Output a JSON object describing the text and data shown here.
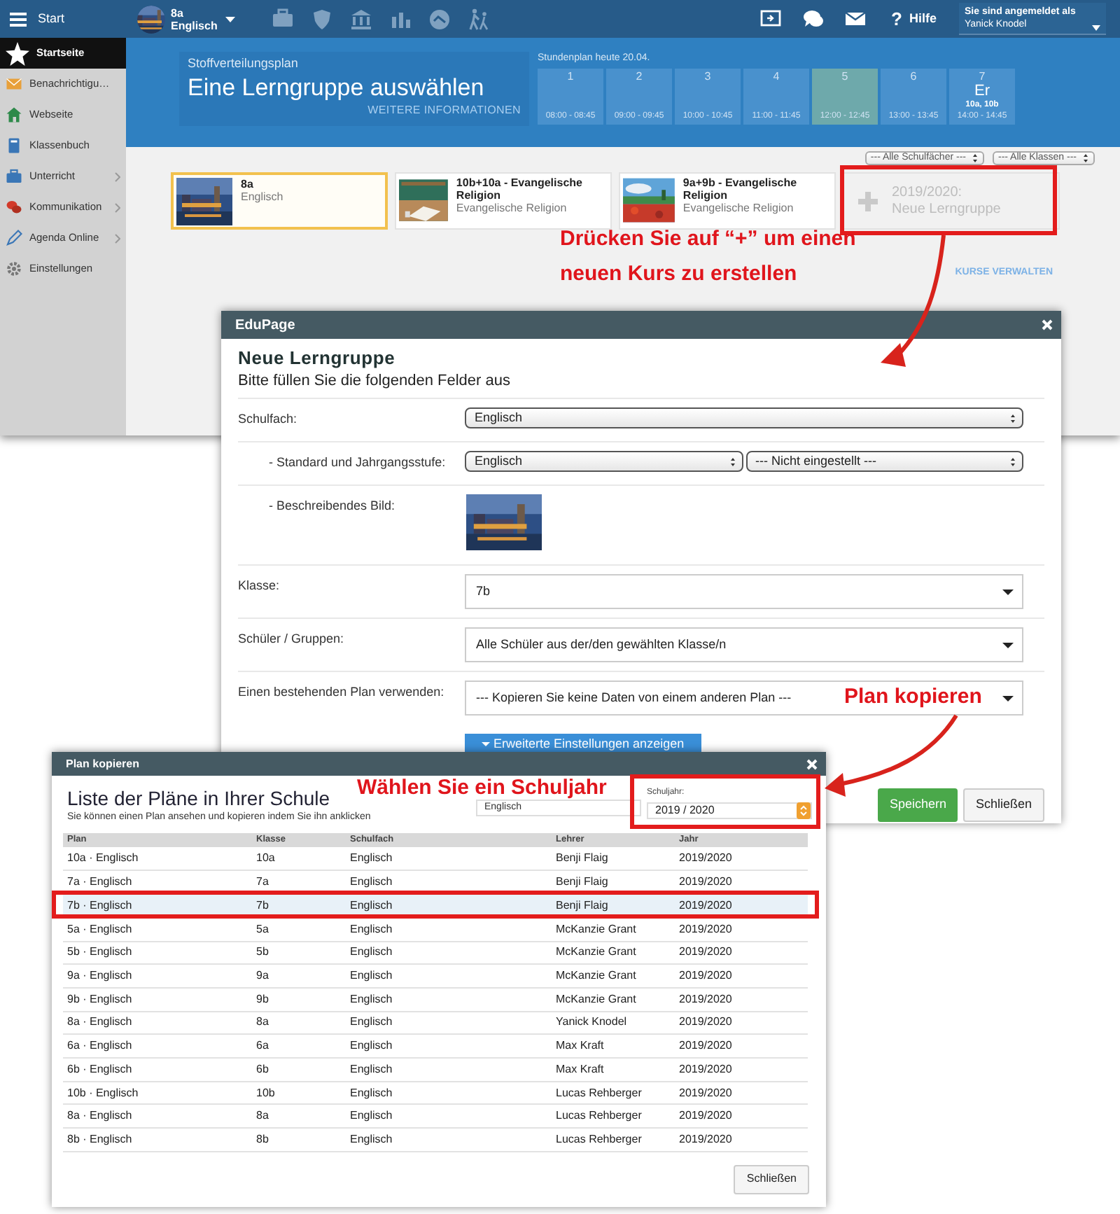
{
  "app": {
    "topbar": {
      "menu_label": "Start",
      "class_name": "8a",
      "class_subject": "Englisch",
      "help_mark": "?",
      "help_label": "Hilfe",
      "login_label": "Sie sind angemeldet als",
      "user": "Yanick Knodel"
    },
    "sidebar": [
      {
        "label": "Startseite",
        "selected": true,
        "expandable": false
      },
      {
        "label": "Benachrichtigu…",
        "selected": false,
        "expandable": false
      },
      {
        "label": "Webseite",
        "selected": false,
        "expandable": false
      },
      {
        "label": "Klassenbuch",
        "selected": false,
        "expandable": false
      },
      {
        "label": "Unterricht",
        "selected": false,
        "expandable": true
      },
      {
        "label": "Kommunikation",
        "selected": false,
        "expandable": true
      },
      {
        "label": "Agenda Online",
        "selected": false,
        "expandable": true
      },
      {
        "label": "Einstellungen",
        "selected": false,
        "expandable": false
      }
    ],
    "banner": {
      "kicker": "Stoffverteilungsplan",
      "title": "Eine Lerngruppe auswählen",
      "link": "WEITERE INFORMATIONEN"
    },
    "schedule": {
      "heading": "Stundenplan heute 20.04.",
      "periods": [
        {
          "number": "1",
          "time": "08:00 - 08:45",
          "current": false
        },
        {
          "number": "2",
          "time": "09:00 - 09:45",
          "current": false
        },
        {
          "number": "3",
          "time": "10:00 - 10:45",
          "current": false
        },
        {
          "number": "4",
          "time": "11:00 - 11:45",
          "current": false
        },
        {
          "number": "5",
          "time": "12:00 - 12:45",
          "current": true
        },
        {
          "number": "6",
          "time": "13:00 - 13:45",
          "current": false
        },
        {
          "number": "7",
          "subject": "Er",
          "classes": "10a, 10b",
          "time": "14:00 - 14:45",
          "current": false
        }
      ]
    },
    "filters": [
      "--- Alle Schulfächer ---",
      "--- Alle Klassen ---"
    ],
    "courses": [
      {
        "kind": "course",
        "title": "8a",
        "subtitle": "Englisch",
        "selected": true
      },
      {
        "kind": "course",
        "title": "10b+10a - Evangelische Religion",
        "subtitle": "Evangelische Religion",
        "selected": false
      },
      {
        "kind": "course",
        "title": "9a+9b - Evangelische Religion",
        "subtitle": "Evangelische Religion",
        "selected": false
      },
      {
        "kind": "new",
        "title": "2019/2020:",
        "subtitle": "Neue Lerngruppe",
        "selected": false
      }
    ],
    "manage_link": "KURSE VERWALTEN"
  },
  "dialog": {
    "title": "EduPage",
    "heading": "Neue Lerngruppe",
    "subheading": "Bitte füllen Sie die folgenden Felder aus",
    "fields": [
      {
        "kind": "select",
        "label": "Schulfach:",
        "values": [
          "Englisch"
        ]
      },
      {
        "kind": "select",
        "label": "- Standard und Jahrgangsstufe:",
        "values": [
          "Englisch",
          "--- Nicht eingestellt ---"
        ]
      },
      {
        "label": "- Beschreibendes Bild:"
      },
      {
        "kind": "dropdown",
        "label": "Klasse:",
        "values": [
          "7b"
        ]
      },
      {
        "kind": "dropdown",
        "label": "Schüler / Gruppen:",
        "values": [
          "Alle Schüler aus der/den gewählten Klasse/n"
        ]
      },
      {
        "kind": "dropdown",
        "label": "Einen bestehenden Plan verwenden:",
        "values": [
          "--- Kopieren Sie keine Daten von einem anderen Plan ---"
        ]
      }
    ],
    "advanced_button": "Erweiterte Einstellungen anzeigen",
    "buttons": [
      {
        "label": "Speichern",
        "primary": true
      },
      {
        "label": "Schließen",
        "primary": false
      }
    ]
  },
  "plan_dialog": {
    "title": "Plan kopieren",
    "heading": "Liste der Pläne in Ihrer Schule",
    "subheading": "Sie können einen Plan ansehen und kopieren indem Sie ihn anklicken",
    "subject_filter": "Englisch",
    "year_label": "Schuljahr:",
    "year_value": "2019 / 2020",
    "columns": [
      "Plan",
      "Klasse",
      "Schulfach",
      "Lehrer",
      "Jahr"
    ],
    "rows": [
      {
        "cells": [
          "10a · Englisch",
          "10a",
          "Englisch",
          "Benji Flaig",
          "2019/2020"
        ],
        "selected": false
      },
      {
        "cells": [
          "7a · Englisch",
          "7a",
          "Englisch",
          "Benji Flaig",
          "2019/2020"
        ],
        "selected": false
      },
      {
        "cells": [
          "7b · Englisch",
          "7b",
          "Englisch",
          "Benji Flaig",
          "2019/2020"
        ],
        "selected": true
      },
      {
        "cells": [
          "5a · Englisch",
          "5a",
          "Englisch",
          "McKanzie Grant",
          "2019/2020"
        ],
        "selected": false
      },
      {
        "cells": [
          "5b · Englisch",
          "5b",
          "Englisch",
          "McKanzie Grant",
          "2019/2020"
        ],
        "selected": false
      },
      {
        "cells": [
          "9a · Englisch",
          "9a",
          "Englisch",
          "McKanzie Grant",
          "2019/2020"
        ],
        "selected": false
      },
      {
        "cells": [
          "9b · Englisch",
          "9b",
          "Englisch",
          "McKanzie Grant",
          "2019/2020"
        ],
        "selected": false
      },
      {
        "cells": [
          "8a · Englisch",
          "8a",
          "Englisch",
          "Yanick Knodel",
          "2019/2020"
        ],
        "selected": false
      },
      {
        "cells": [
          "6a · Englisch",
          "6a",
          "Englisch",
          "Max Kraft",
          "2019/2020"
        ],
        "selected": false
      },
      {
        "cells": [
          "6b · Englisch",
          "6b",
          "Englisch",
          "Max Kraft",
          "2019/2020"
        ],
        "selected": false
      },
      {
        "cells": [
          "10b · Englisch",
          "10b",
          "Englisch",
          "Lucas Rehberger",
          "2019/2020"
        ],
        "selected": false
      },
      {
        "cells": [
          "8a · Englisch",
          "8a",
          "Englisch",
          "Lucas Rehberger",
          "2019/2020"
        ],
        "selected": false
      },
      {
        "cells": [
          "8b · Englisch",
          "8b",
          "Englisch",
          "Lucas Rehberger",
          "2019/2020"
        ],
        "selected": false
      }
    ],
    "close_button": "Schließen"
  },
  "annotations": [
    "Drücken Sie auf “+” um einen neuen Kurs zu erstellen",
    "Plan kopieren",
    "Wählen Sie ein Schuljahr"
  ]
}
